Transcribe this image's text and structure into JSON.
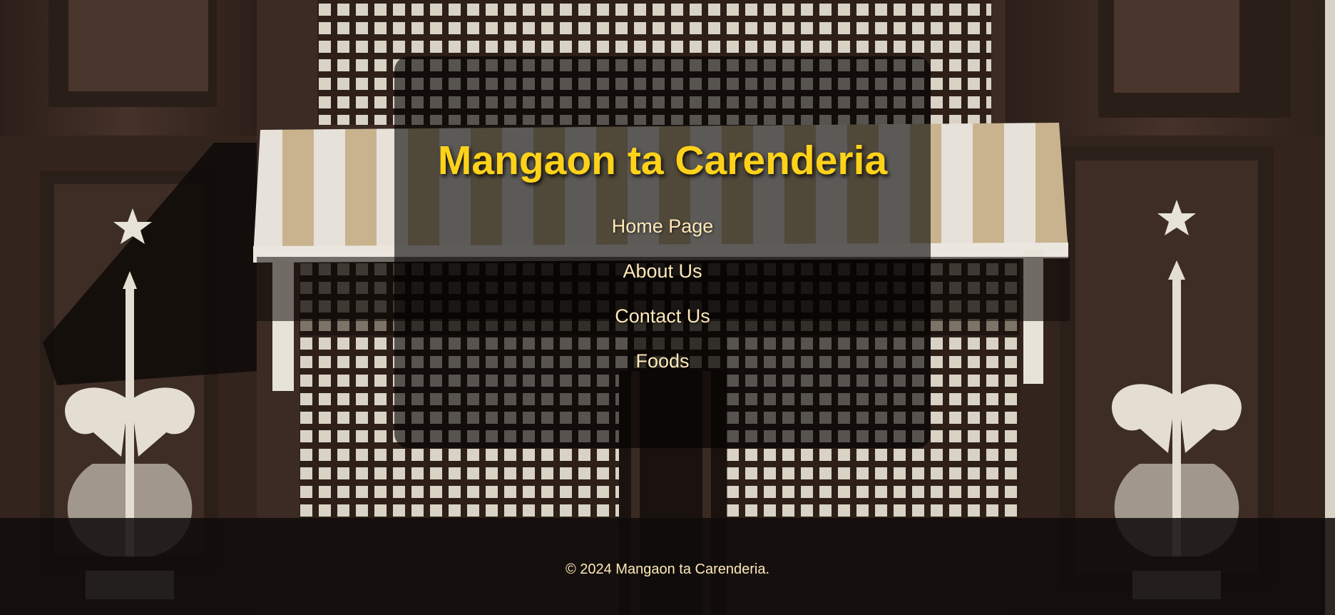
{
  "site": {
    "title": "Mangaon ta Carenderia"
  },
  "nav": {
    "items": [
      {
        "label": "Home Page"
      },
      {
        "label": "About Us"
      },
      {
        "label": "Contact Us"
      },
      {
        "label": "Foods"
      }
    ]
  },
  "footer": {
    "copyright": "© 2024 Mangaon ta Carenderia."
  },
  "colors": {
    "title": "#ffd21a",
    "nav_link": "#ffe9b8",
    "panel_overlay": "#000000",
    "footer_bg": "#0f0c0a",
    "wood": "#3a2a22"
  },
  "background": {
    "icons": [
      "wooden-door-panels-image",
      "capiz-window-image",
      "striped-awning-image",
      "star-icon",
      "ornamental-scroll-icon"
    ]
  }
}
